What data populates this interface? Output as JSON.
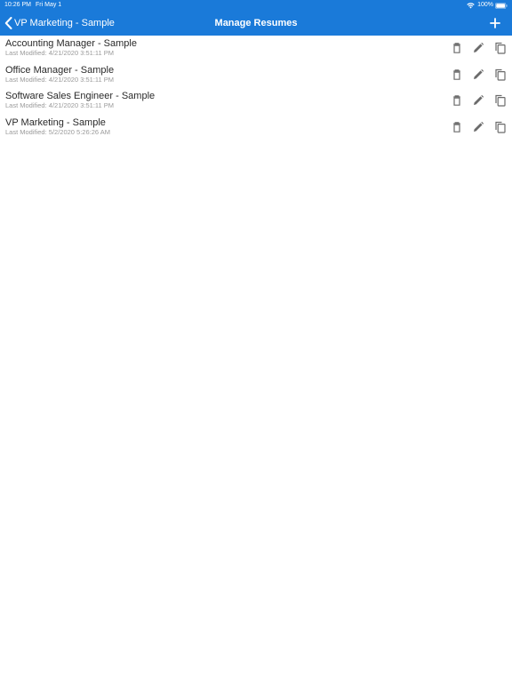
{
  "status_bar": {
    "time": "10:26 PM",
    "date": "Fri May 1",
    "battery": "100%"
  },
  "nav": {
    "back_label": "VP Marketing - Sample",
    "title": "Manage Resumes"
  },
  "colors": {
    "header_bg": "#1a7ad9",
    "header_text": "#ffffff",
    "title_text": "#2a2a2a",
    "subtitle_text": "#9a9a9a",
    "icon": "#6b6b6b"
  },
  "resumes": [
    {
      "title": "Accounting Manager - Sample",
      "modified": "Last Modified: 4/21/2020 3:51:11 PM"
    },
    {
      "title": "Office Manager - Sample",
      "modified": "Last Modified: 4/21/2020 3:51:11 PM"
    },
    {
      "title": "Software Sales Engineer - Sample",
      "modified": "Last Modified: 4/21/2020 3:51:11 PM"
    },
    {
      "title": "VP Marketing - Sample",
      "modified": "Last Modified: 5/2/2020 5:26:26 AM"
    }
  ]
}
